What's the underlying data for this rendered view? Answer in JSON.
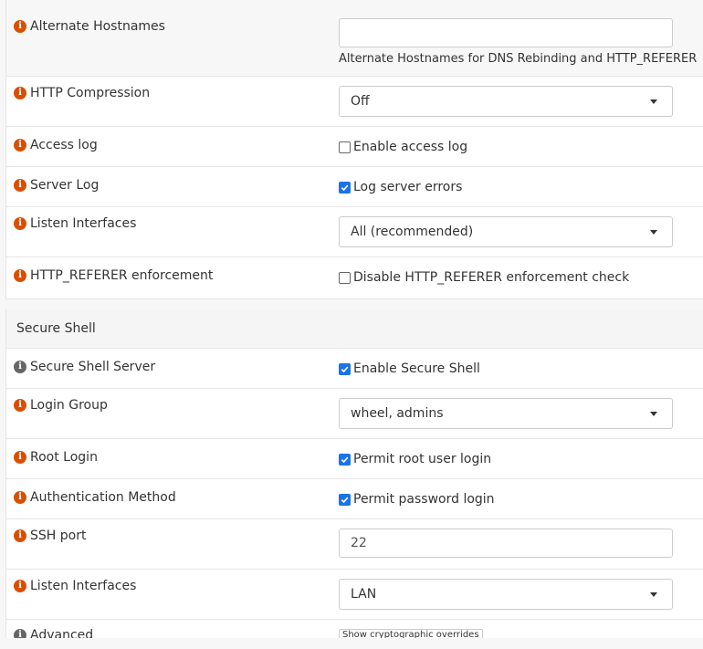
{
  "colors": {
    "info_orange": "#d94f00",
    "info_gray": "#666666",
    "check_blue": "#1a73e8"
  },
  "webgui": {
    "alternate_hostnames": {
      "label": "Alternate Hostnames",
      "value": "",
      "hint": "Alternate Hostnames for DNS Rebinding and HTTP_REFERER"
    },
    "http_compression": {
      "label": "HTTP Compression",
      "value": "Off"
    },
    "access_log": {
      "label": "Access log",
      "checkbox_label": "Enable access log",
      "checked": false
    },
    "server_log": {
      "label": "Server Log",
      "checkbox_label": "Log server errors",
      "checked": true
    },
    "listen_interfaces": {
      "label": "Listen Interfaces",
      "value": "All (recommended)"
    },
    "referer_enforcement": {
      "label": "HTTP_REFERER enforcement",
      "checkbox_label": "Disable HTTP_REFERER enforcement check",
      "checked": false
    }
  },
  "ssh": {
    "section_title": "Secure Shell",
    "server": {
      "label": "Secure Shell Server",
      "checkbox_label": "Enable Secure Shell",
      "checked": true
    },
    "login_group": {
      "label": "Login Group",
      "value": "wheel, admins"
    },
    "root_login": {
      "label": "Root Login",
      "checkbox_label": "Permit root user login",
      "checked": true
    },
    "auth_method": {
      "label": "Authentication Method",
      "checkbox_label": "Permit password login",
      "checked": true
    },
    "port": {
      "label": "SSH port",
      "value": "22"
    },
    "listen_interfaces": {
      "label": "Listen Interfaces",
      "value": "LAN"
    },
    "advanced": {
      "label": "Advanced",
      "button_label": "Show cryptographic overrides"
    }
  },
  "icons": {
    "info": "info-circle-icon",
    "check": "check-icon",
    "caret": "caret-down-icon"
  }
}
